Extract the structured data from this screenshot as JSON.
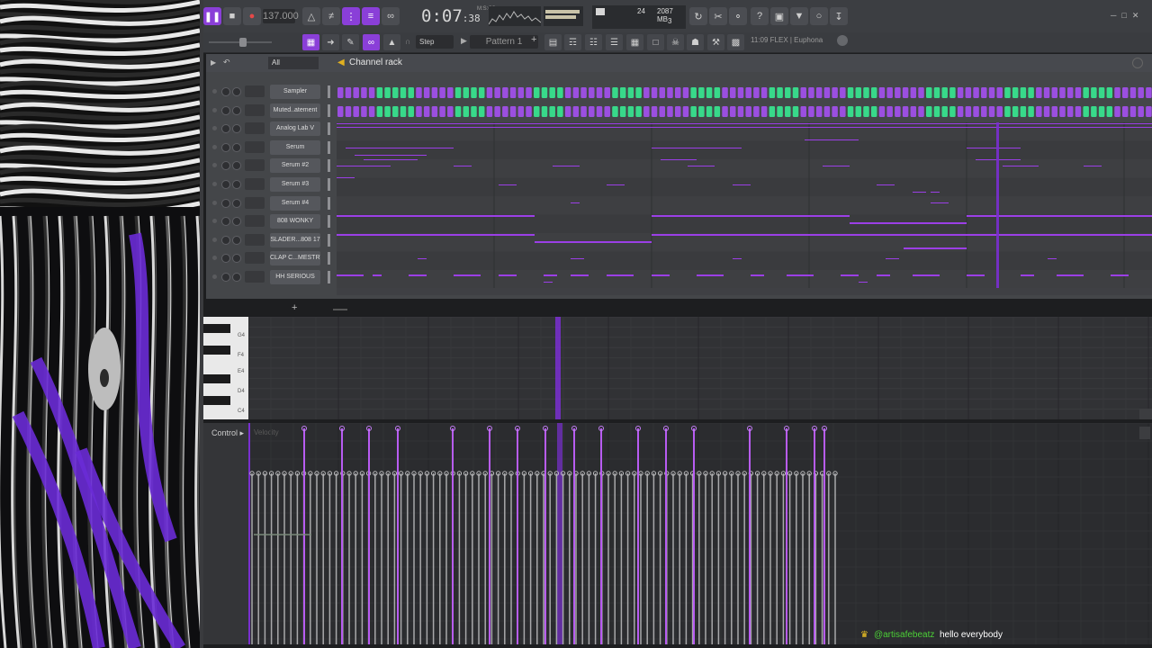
{
  "toolbar": {
    "tempo": "137.000",
    "time_main": "0:07",
    "time_sub": "38",
    "time_unit": "M:S:CS",
    "cpu_poly": "24",
    "memory": "2087 MB",
    "cpu_voices": "3",
    "step_mode": "Step",
    "pattern": "Pattern 1",
    "hint": "11:09  FLEX | Euphona"
  },
  "rack": {
    "filter": "All",
    "title": "Channel rack",
    "add_label": "+",
    "channels": [
      {
        "name": "Sampler"
      },
      {
        "name": "Muted..atement"
      },
      {
        "name": "Analog Lab V"
      },
      {
        "name": "Serum"
      },
      {
        "name": "Serum #2"
      },
      {
        "name": "Serum #3"
      },
      {
        "name": "Serum #4"
      },
      {
        "name": "808 WONKY"
      },
      {
        "name": "SLADER...808 17"
      },
      {
        "name": "CLAP C...MESTRY"
      },
      {
        "name": "HH SERIOUS"
      }
    ],
    "pad_on_color": "#38d98a",
    "pad_off_color": "#9b4fe0"
  },
  "piano": {
    "keys": [
      "G4",
      "F4",
      "E4",
      "D4",
      "C4"
    ]
  },
  "control": {
    "label": "Control",
    "param": "Velocity"
  },
  "chat": {
    "user": "@artisafebeatz",
    "message": "hello everybody"
  },
  "colors": {
    "accent": "#8a3fd8",
    "note": "#9b3fe6",
    "playhead": "#7a2fd0"
  }
}
